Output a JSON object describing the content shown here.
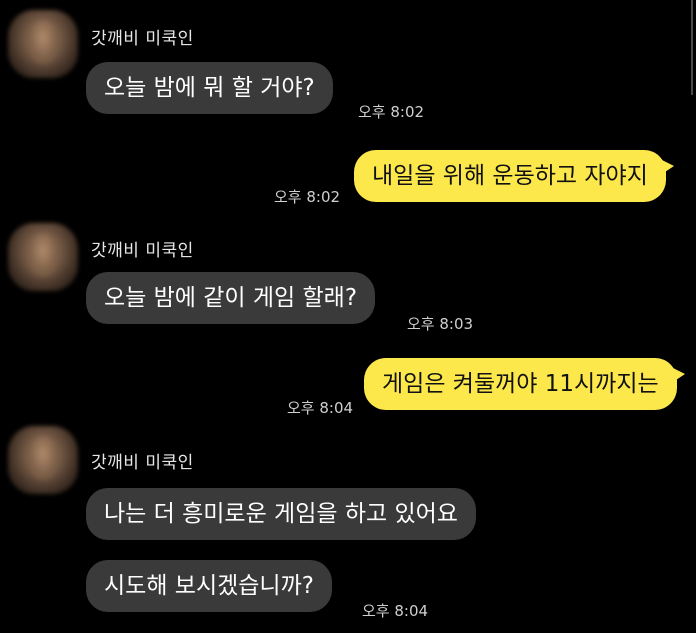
{
  "messages": [
    {
      "sender": "갓깨비 미쿡인",
      "text": "오늘 밤에 뭐 할 거야?",
      "time": "오후 8:02",
      "direction": "in"
    },
    {
      "text": "내일을 위해 운동하고 자야지",
      "time": "오후 8:02",
      "direction": "out"
    },
    {
      "sender": "갓깨비 미쿡인",
      "text": "오늘 밤에 같이 게임 할래?",
      "time": "오후 8:03",
      "direction": "in"
    },
    {
      "text": "게임은 켜둘꺼야 11시까지는",
      "time": "오후 8:04",
      "direction": "out"
    },
    {
      "sender": "갓깨비 미쿡인",
      "text": "나는 더 흥미로운 게임을 하고 있어요",
      "direction": "in"
    },
    {
      "text": "시도해 보시겠습니까?",
      "time": "오후 8:04",
      "direction": "in"
    }
  ],
  "colors": {
    "background": "#000000",
    "incoming_bubble": "#3a3a3a",
    "outgoing_bubble": "#fde84c",
    "sender_text": "#e6e6e6",
    "time_text": "#cfcfcf"
  }
}
